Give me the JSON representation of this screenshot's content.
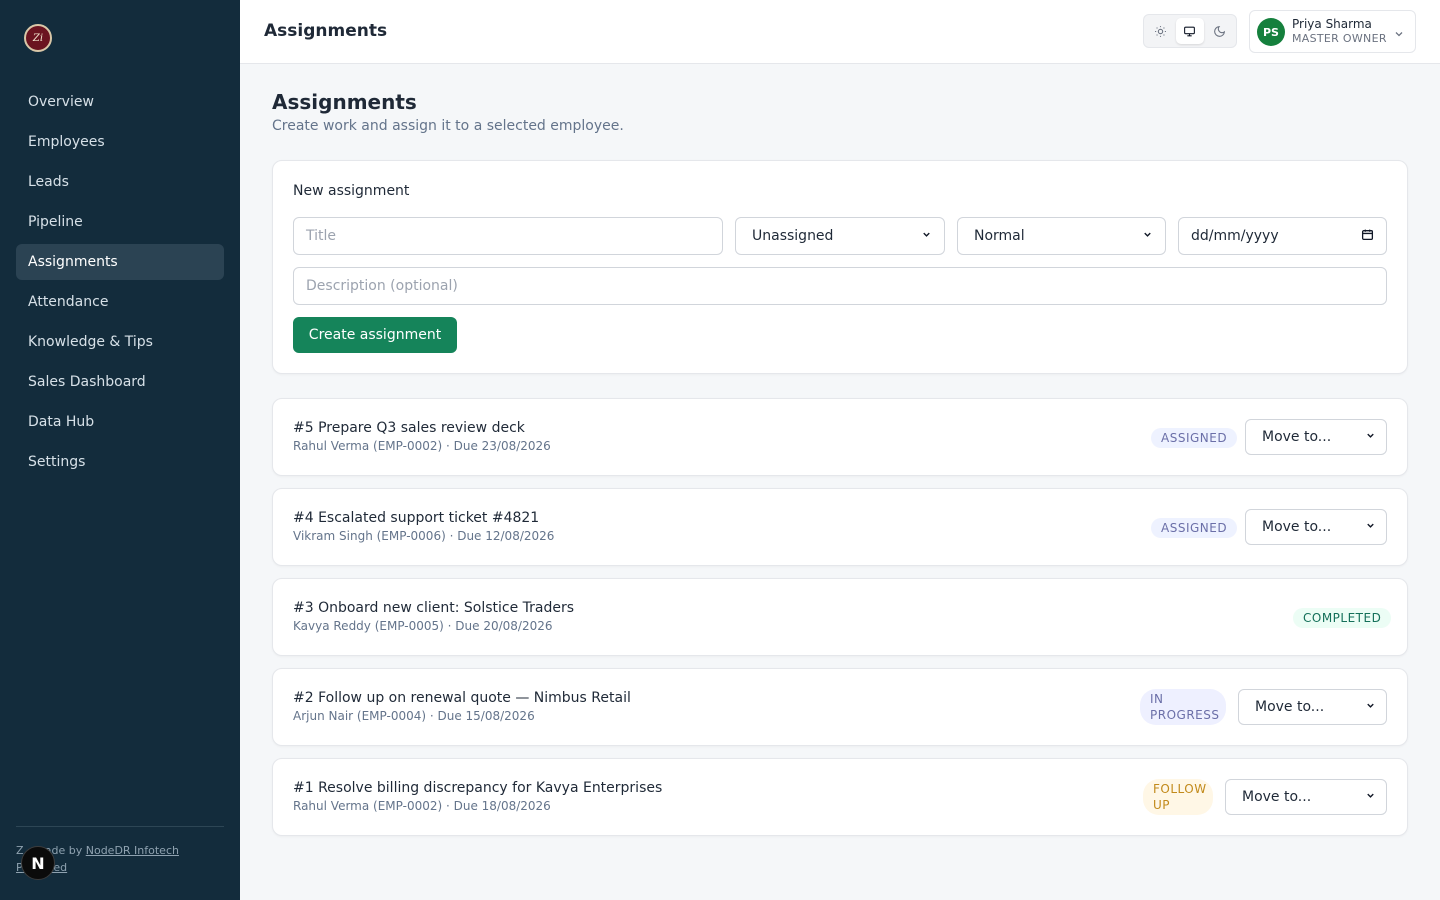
{
  "app": {
    "logo_text": "Zi"
  },
  "sidebar": {
    "items": [
      {
        "label": "Overview"
      },
      {
        "label": "Employees"
      },
      {
        "label": "Leads"
      },
      {
        "label": "Pipeline"
      },
      {
        "label": "Assignments",
        "active": true
      },
      {
        "label": "Attendance"
      },
      {
        "label": "Knowledge & Tips"
      },
      {
        "label": "Sales Dashboard"
      },
      {
        "label": "Data Hub"
      },
      {
        "label": "Settings"
      }
    ],
    "footer_prefix": "Z",
    "footer_mid": " · made by ",
    "footer_link1": "NodeDR Infotech",
    "footer_link2_prefix": "P",
    "footer_link2": " Limited",
    "badge": "N"
  },
  "header": {
    "title": "Assignments",
    "theme_icons": [
      "sun-icon",
      "monitor-icon",
      "moon-icon"
    ],
    "active_theme": "monitor-icon",
    "user": {
      "initials": "PS",
      "name": "Priya Sharma",
      "role": "MASTER OWNER"
    }
  },
  "page": {
    "title": "Assignments",
    "subtitle": "Create work and assign it to a selected employee."
  },
  "form": {
    "section_label": "New assignment",
    "title_placeholder": "Title",
    "assignee_value": "Unassigned",
    "priority_value": "Normal",
    "date_placeholder": "dd/mm/yyyy",
    "description_placeholder": "Description (optional)",
    "submit_label": "Create assignment"
  },
  "assignments": [
    {
      "title": "#5 Prepare Q3 sales review deck",
      "meta": "Rahul Verma (EMP-0002) · Due 23/08/2026",
      "status": "ASSIGNED",
      "move": "Move to..."
    },
    {
      "title": "#4 Escalated support ticket #4821",
      "meta": "Vikram Singh (EMP-0006) · Due 12/08/2026",
      "status": "ASSIGNED",
      "move": "Move to..."
    },
    {
      "title": "#3 Onboard new client: Solstice Traders",
      "meta": "Kavya Reddy (EMP-0005) · Due 20/08/2026",
      "status": "COMPLETED"
    },
    {
      "title": "#2 Follow up on renewal quote — Nimbus Retail",
      "meta": "Arjun Nair (EMP-0004) · Due 15/08/2026",
      "status_line1": "IN",
      "status_line2": "PROGRESS",
      "move": "Move to..."
    },
    {
      "title": "#1 Resolve billing discrepancy for Kavya Enterprises",
      "meta": "Rahul Verma (EMP-0002) · Due 18/08/2026",
      "status_line1": "FOLLOW",
      "status_line2": "UP",
      "move": "Move to..."
    }
  ],
  "colors": {
    "sidebar_bg": "#132c3c",
    "accent_green": "#15845a",
    "page_bg": "#f5f7f9"
  }
}
